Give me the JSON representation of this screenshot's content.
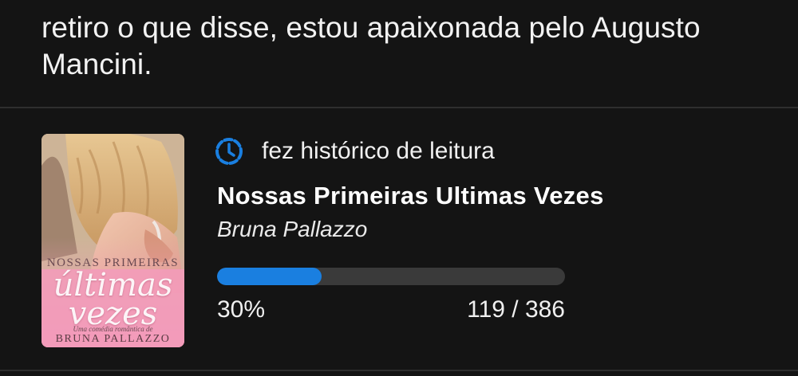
{
  "post": {
    "text": "retiro o que disse, estou apaixonada pelo Augusto Mancini."
  },
  "activity": {
    "icon": "history-icon",
    "label": "fez histórico de leitura",
    "accent_color": "#1a7fe0"
  },
  "book": {
    "title": "Nossas Primeiras Ultimas Vezes",
    "author": "Bruna Pallazzo",
    "cover": {
      "series_text": "NOSSAS PRIMEIRAS",
      "script_text": "últimas vezes",
      "tagline": "Uma comédia romântica de",
      "author_text": "BRUNA PALLAZZO"
    }
  },
  "progress": {
    "fraction": 0.3,
    "percent_label": "30%",
    "pages_label": "119 / 386",
    "fill_color": "#1a7fe0",
    "track_color": "#3a3a3a"
  }
}
